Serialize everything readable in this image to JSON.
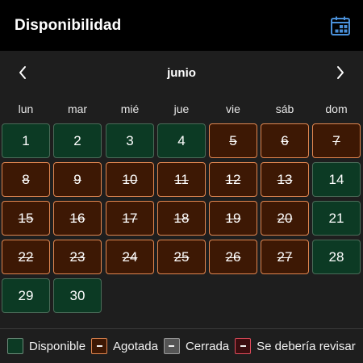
{
  "header": {
    "title": "Disponibilidad",
    "calendar_icon": "calendar-icon",
    "accent": "#4a90d9"
  },
  "month_nav": {
    "month": "junio",
    "prev_icon": "chevron-left-icon",
    "next_icon": "chevron-right-icon"
  },
  "weekdays": [
    "lun",
    "mar",
    "mié",
    "jue",
    "vie",
    "sáb",
    "dom"
  ],
  "days": [
    {
      "day": "1",
      "status": "available"
    },
    {
      "day": "2",
      "status": "available"
    },
    {
      "day": "3",
      "status": "available"
    },
    {
      "day": "4",
      "status": "available"
    },
    {
      "day": "5",
      "status": "soldout"
    },
    {
      "day": "6",
      "status": "soldout"
    },
    {
      "day": "7",
      "status": "soldout"
    },
    {
      "day": "8",
      "status": "soldout"
    },
    {
      "day": "9",
      "status": "soldout"
    },
    {
      "day": "10",
      "status": "soldout"
    },
    {
      "day": "11",
      "status": "soldout"
    },
    {
      "day": "12",
      "status": "soldout"
    },
    {
      "day": "13",
      "status": "soldout"
    },
    {
      "day": "14",
      "status": "available"
    },
    {
      "day": "15",
      "status": "soldout"
    },
    {
      "day": "16",
      "status": "soldout"
    },
    {
      "day": "17",
      "status": "soldout"
    },
    {
      "day": "18",
      "status": "soldout"
    },
    {
      "day": "19",
      "status": "soldout"
    },
    {
      "day": "20",
      "status": "soldout"
    },
    {
      "day": "21",
      "status": "available"
    },
    {
      "day": "22",
      "status": "soldout"
    },
    {
      "day": "23",
      "status": "soldout"
    },
    {
      "day": "24",
      "status": "soldout"
    },
    {
      "day": "25",
      "status": "soldout"
    },
    {
      "day": "26",
      "status": "soldout"
    },
    {
      "day": "27",
      "status": "soldout"
    },
    {
      "day": "28",
      "status": "available"
    },
    {
      "day": "29",
      "status": "available"
    },
    {
      "day": "30",
      "status": "available"
    }
  ],
  "legend": {
    "available": "Disponible",
    "soldout": "Agotada",
    "closed": "Cerrada",
    "review": "Se debería revisar"
  },
  "colors": {
    "available_bg": "#0c3a24",
    "soldout_bg": "#3d1804",
    "soldout_border": "#e08650",
    "closed_bg": "#555555",
    "review_border": "#e04c5c"
  }
}
